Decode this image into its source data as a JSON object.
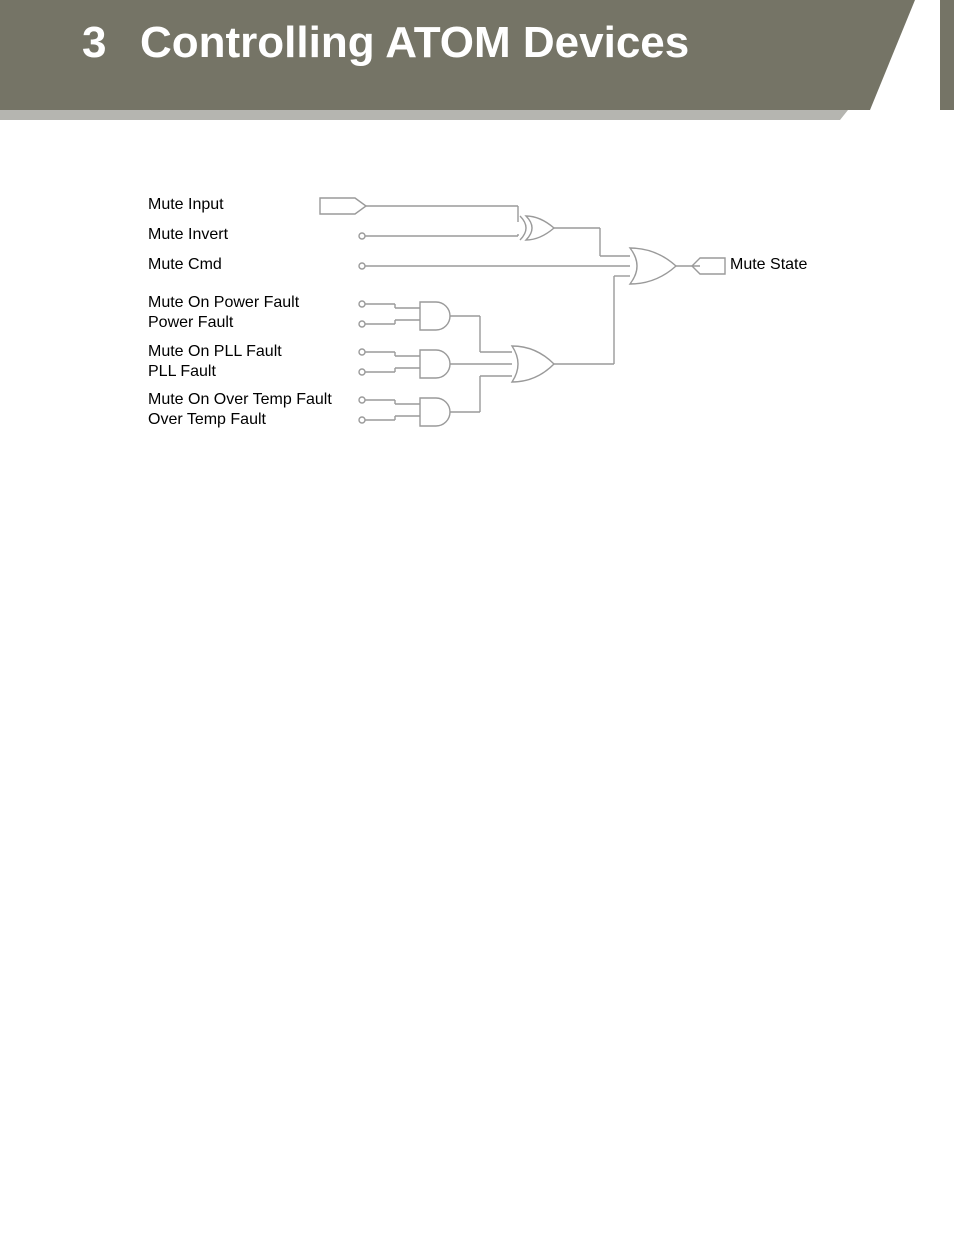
{
  "chapter": {
    "number": "3",
    "title": "Controlling ATOM Devices"
  },
  "diagram": {
    "labels": {
      "mute_input": "Mute Input",
      "mute_invert": "Mute Invert",
      "mute_cmd": "Mute Cmd",
      "mute_on_power_fault": "Mute On Power Fault",
      "power_fault": "Power Fault",
      "mute_on_pll_fault": "Mute On PLL Fault",
      "pll_fault": "PLL Fault",
      "mute_on_over_temp_fault": "Mute On Over Temp Fault",
      "over_temp_fault": "Over Temp Fault",
      "mute_state": "Mute State"
    }
  }
}
